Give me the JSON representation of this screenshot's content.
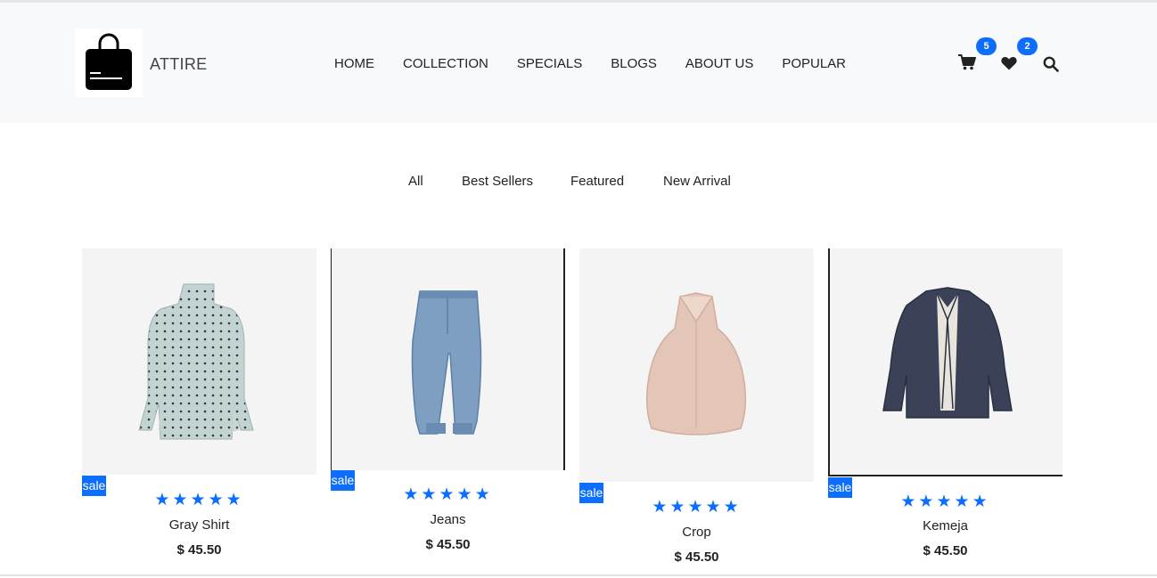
{
  "brand": {
    "name": "ATTIRE",
    "logo_icon": "shopping-bag-icon"
  },
  "nav": [
    "HOME",
    "COLLECTION",
    "SPECIALS",
    "BLOGS",
    "ABOUT US",
    "POPULAR"
  ],
  "header_icons": {
    "cart": {
      "icon": "cart-icon",
      "count": "5"
    },
    "wishlist": {
      "icon": "heart-icon",
      "count": "2"
    },
    "search": {
      "icon": "search-icon"
    }
  },
  "filters": [
    "All",
    "Best Sellers",
    "Featured",
    "New Arrival"
  ],
  "products": [
    {
      "title": "Gray Shirt",
      "price": "$ 45.50",
      "badge": "sale",
      "rating": 5,
      "image": "blouse"
    },
    {
      "title": "Jeans",
      "price": "$ 45.50",
      "badge": "sale",
      "rating": 5,
      "image": "jeans"
    },
    {
      "title": "Crop",
      "price": "$ 45.50",
      "badge": "sale",
      "rating": 5,
      "image": "crop-top"
    },
    {
      "title": "Kemeja",
      "price": "$ 45.50",
      "badge": "sale",
      "rating": 5,
      "image": "jacket"
    }
  ],
  "colors": {
    "accent": "#0d6efd",
    "header_bg": "#f8f9fa",
    "card_bg": "#f4f4f4"
  }
}
